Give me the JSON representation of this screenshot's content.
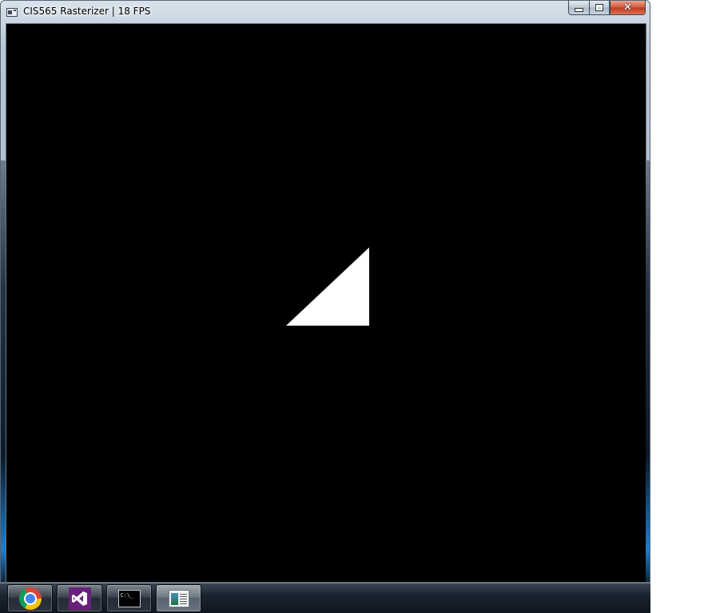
{
  "window": {
    "title": "CIS565 Rasterizer | 18 FPS",
    "app_icon": "window-app-icon",
    "caption_buttons": {
      "minimize": "minimize-icon",
      "maximize": "maximize-icon",
      "close": "close-icon"
    }
  },
  "canvas": {
    "background_color": "#000000",
    "shape": "triangle",
    "shape_color": "#ffffff"
  },
  "taskbar": {
    "items": [
      {
        "name": "chrome",
        "icon": "chrome-icon"
      },
      {
        "name": "visual-studio",
        "icon": "visual-studio-icon"
      },
      {
        "name": "command-prompt",
        "icon": "command-prompt-icon",
        "text": "C:\\_"
      },
      {
        "name": "rasterizer-window",
        "icon": "window-app-icon",
        "active": true
      }
    ]
  },
  "colors": {
    "chrome_red": "#db4437",
    "chrome_yellow": "#f4c20d",
    "chrome_green": "#0f9d58",
    "chrome_blue": "#4285f4",
    "vs_purple": "#68217a"
  }
}
